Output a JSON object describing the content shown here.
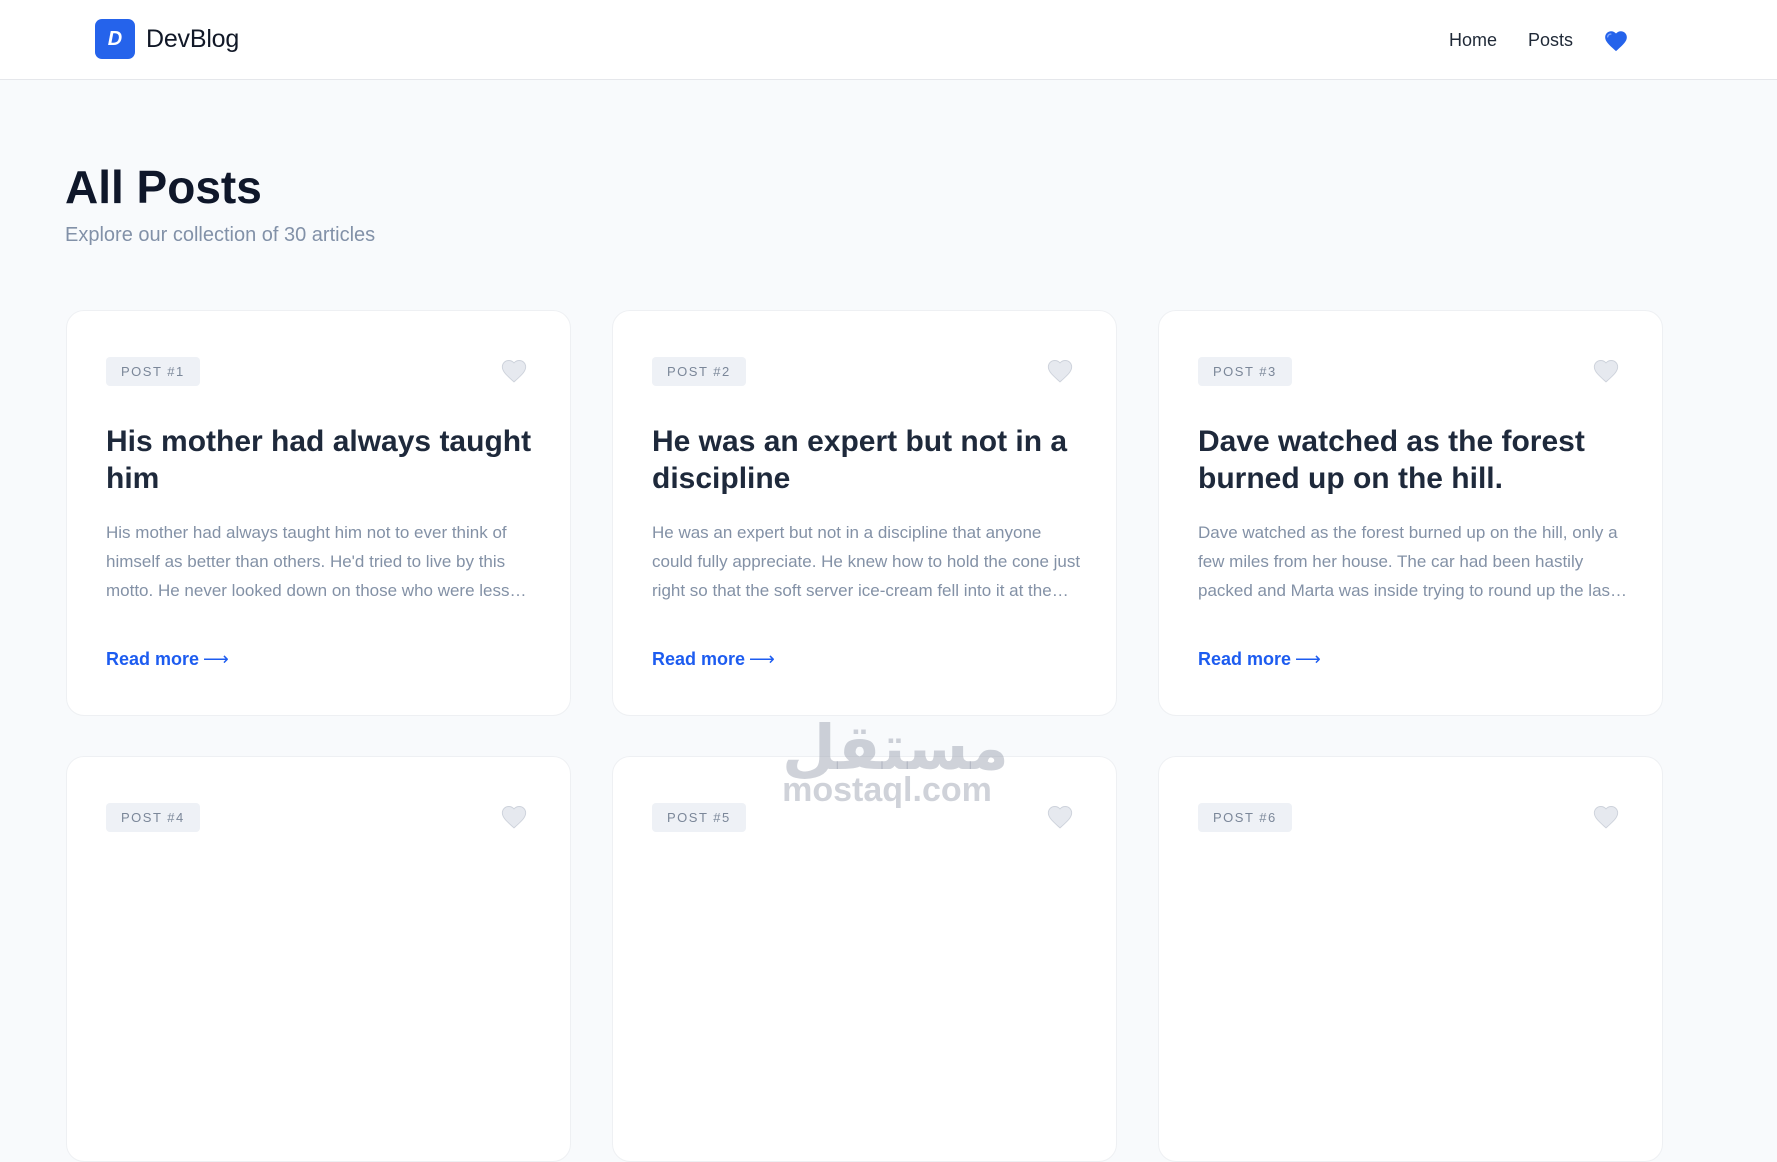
{
  "nav": {
    "logo_letter": "D",
    "brand": "DevBlog",
    "links": [
      "Home",
      "Posts"
    ],
    "heart_icon": "blue-heart-icon",
    "accent_color": "#2563eb"
  },
  "header": {
    "title": "All Posts",
    "subtitle": "Explore our collection of 30 articles"
  },
  "posts": [
    {
      "badge": "POST #1",
      "title": "His mother had always taught him",
      "excerpt": "His mother had always taught him not to ever think of himself as better than others. He'd tried to live by this motto. He never looked down on those who were less fortunate or who had less money than him.",
      "read_more": "Read more"
    },
    {
      "badge": "POST #2",
      "title": "He was an expert but not in a discipline",
      "excerpt": "He was an expert but not in a discipline that anyone could fully appreciate. He knew how to hold the cone just right so that the soft server ice-cream fell into it at the precise angle to form a perfect cone each and every time.",
      "read_more": "Read more"
    },
    {
      "badge": "POST #3",
      "title": "Dave watched as the forest burned up on the hill.",
      "excerpt": "Dave watched as the forest burned up on the hill, only a few miles from her house. The car had been hastily packed and Marta was inside trying to round up the last of the pets.",
      "read_more": "Read more"
    },
    {
      "badge": "POST #4",
      "title": "",
      "excerpt": "",
      "read_more": ""
    },
    {
      "badge": "POST #5",
      "title": "",
      "excerpt": "",
      "read_more": ""
    },
    {
      "badge": "POST #6",
      "title": "",
      "excerpt": "",
      "read_more": ""
    }
  ],
  "watermark": {
    "arabic": "مستقل",
    "latin": "mostaql.com"
  }
}
